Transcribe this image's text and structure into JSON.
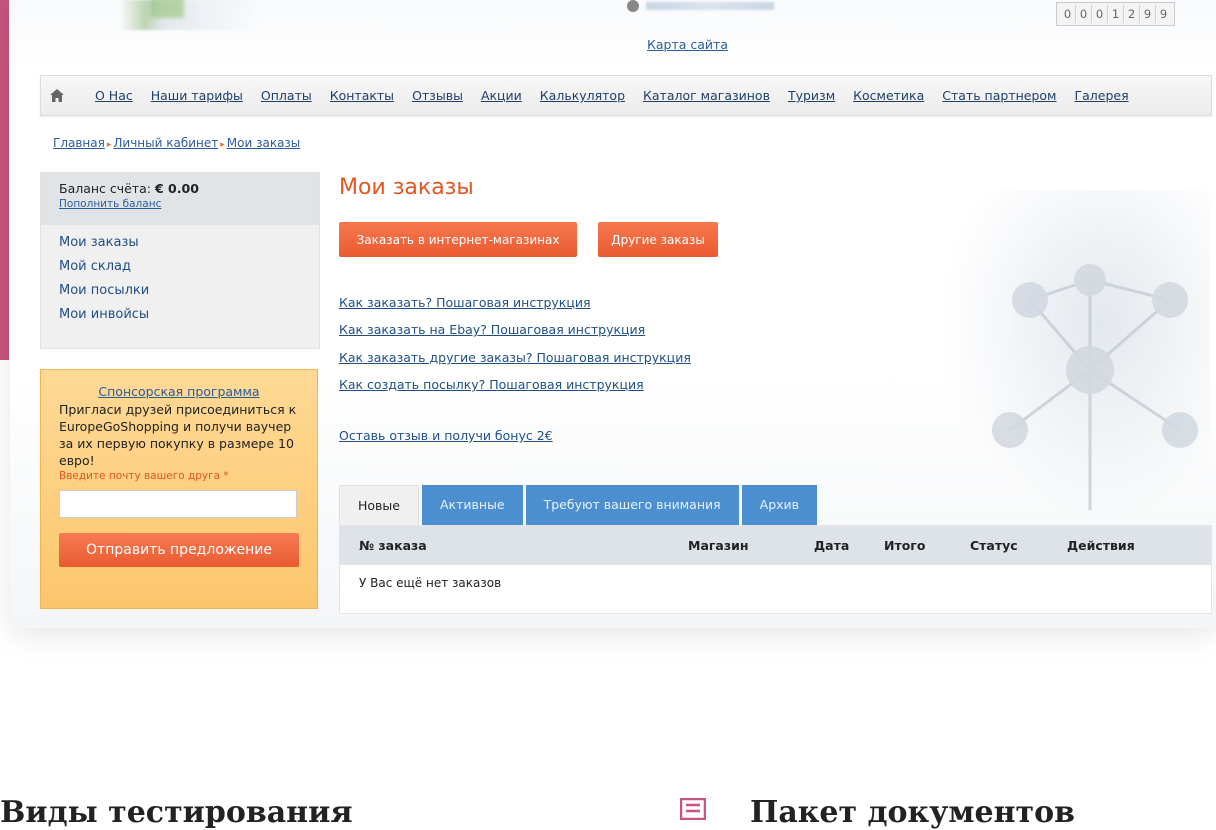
{
  "header": {
    "sitemap": "Карта сайта",
    "counter": [
      "0",
      "0",
      "0",
      "1",
      "2",
      "9",
      "9"
    ]
  },
  "nav": {
    "items": [
      "О Нас",
      "Наши тарифы",
      "Оплаты",
      "Контакты",
      "Отзывы",
      "Акции",
      "Калькулятор",
      "Каталог магазинов",
      "Туризм",
      "Косметика",
      "Стать партнером",
      "Галерея"
    ]
  },
  "breadcrumb": {
    "items": [
      "Главная",
      "Личный кабинет",
      "Мои заказы"
    ]
  },
  "sidebar": {
    "balance_label": "Баланс счёта:",
    "balance_value": "€ 0.00",
    "topup": "Пополнить баланс",
    "links": [
      "Мои заказы",
      "Мой склад",
      "Мои посылки",
      "Мои инвойсы"
    ]
  },
  "sponsor": {
    "title": "Спонсорская программа",
    "text": "Пригласи друзей присоединиться к EuropeGoShopping и получи ваучер за их первую покупку в размере 10 евро!",
    "field_label": "Введите почту вашего друга *",
    "button": "Отправить предложение"
  },
  "main": {
    "title": "Мои заказы",
    "btn_shops": "Заказать в интернет-магазинах",
    "btn_other": "Другие заказы",
    "links": [
      "Как заказать? Пошаговая инструкция",
      "Как заказать на Ebay? Пошаговая инструкция",
      "Как заказать другие заказы? Пошаговая инструкция",
      "Как создать посылку? Пошаговая инструкция"
    ],
    "review_link": "Оставь отзыв и получи бонус 2€",
    "tabs": [
      "Новые",
      "Активные",
      "Требуют вашего внимания",
      "Архив"
    ],
    "table_headers": [
      "№ заказа",
      "Магазин",
      "Дата",
      "Итого",
      "Статус",
      "Действия"
    ],
    "empty_message": "У Вас ещё нет заказов"
  },
  "bottom": {
    "left_heading": "Виды тестирования",
    "right_heading": "Пакет документов"
  },
  "colors": {
    "accent_orange": "#ea5a30",
    "tab_blue": "#4b8fd1",
    "link_blue": "#1f4f86",
    "pink_strip": "#c8557e"
  }
}
